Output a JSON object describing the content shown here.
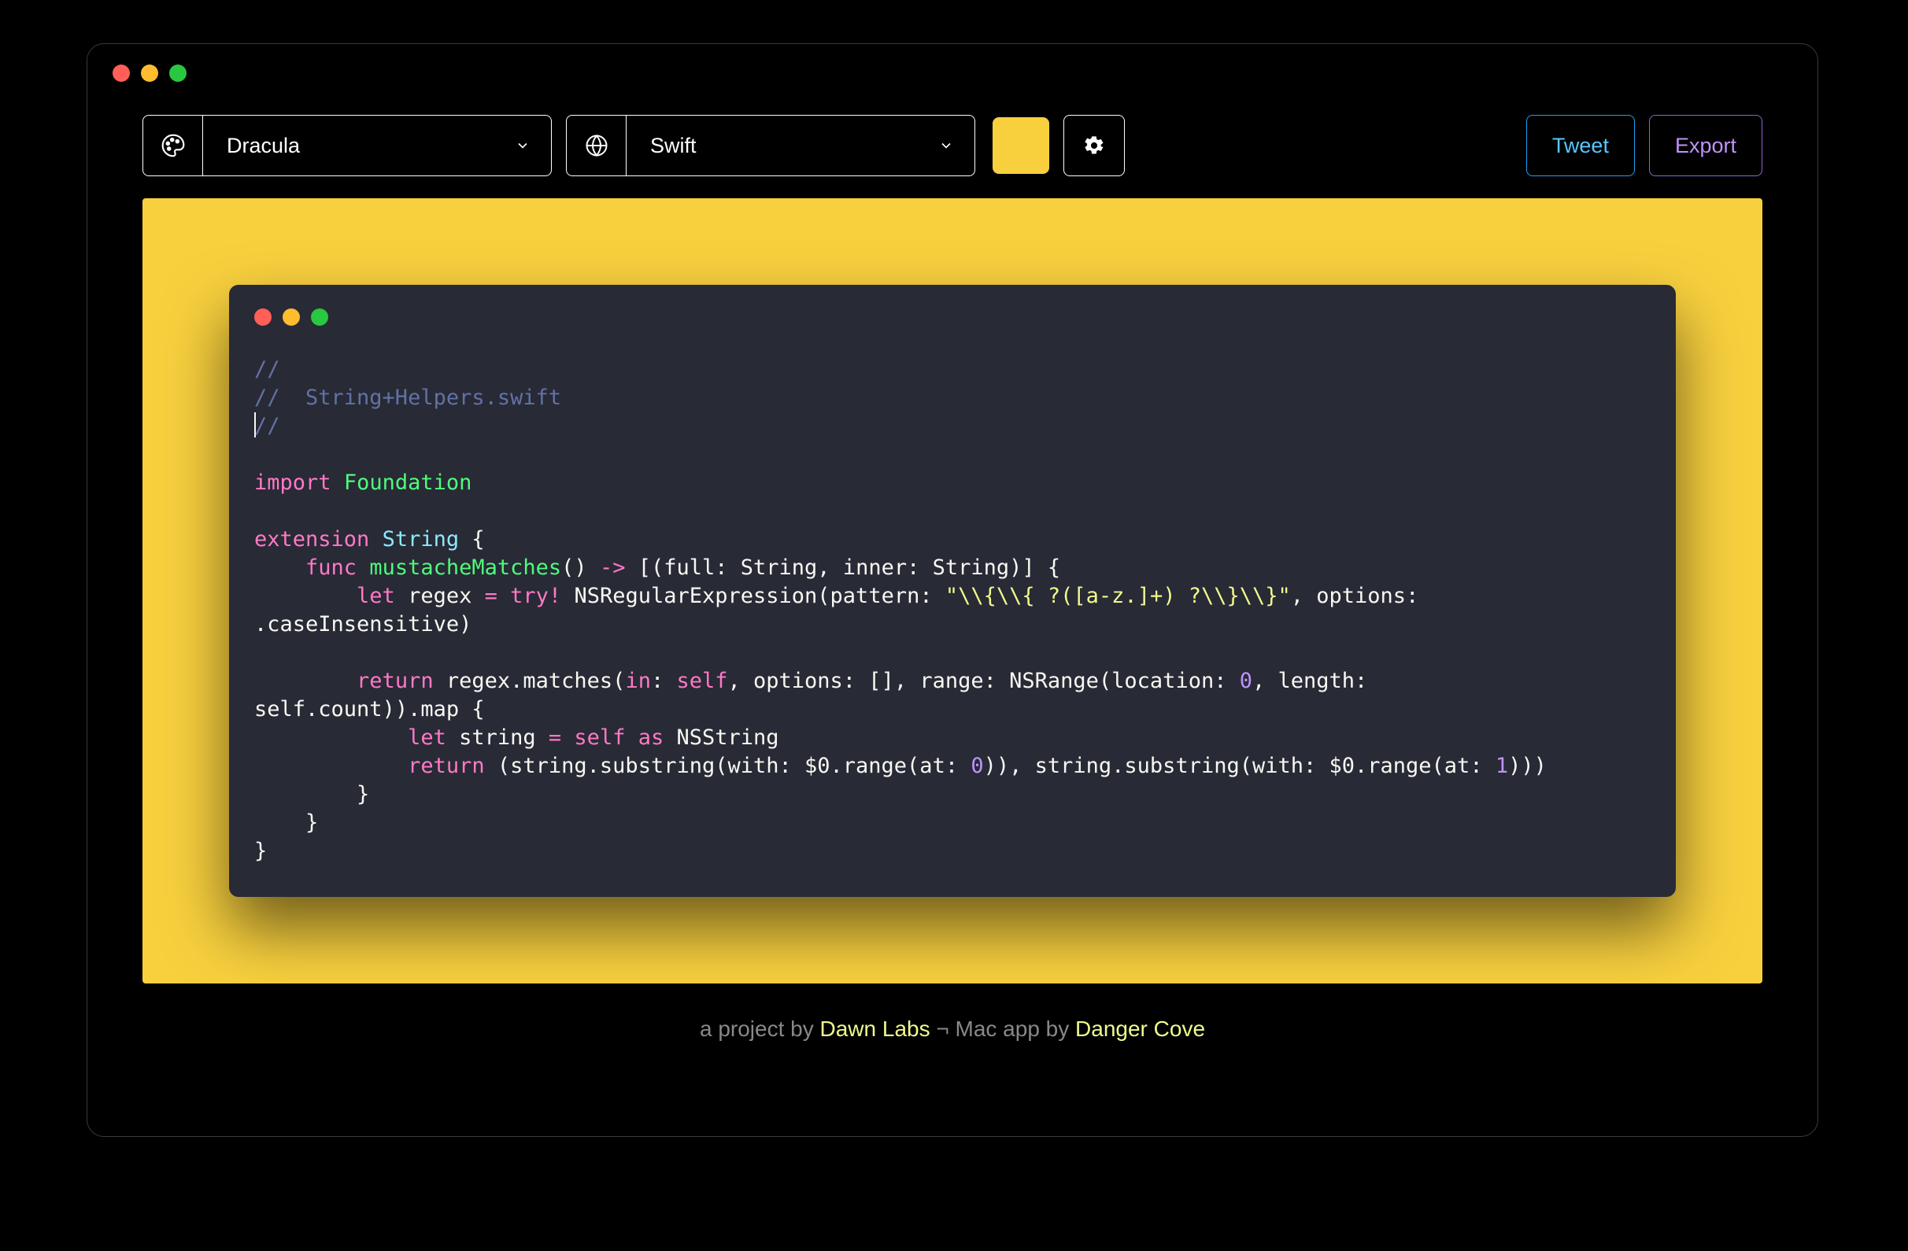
{
  "toolbar": {
    "theme_select": {
      "label": "Dracula"
    },
    "lang_select": {
      "label": "Swift"
    },
    "tweet_label": "Tweet",
    "export_label": "Export",
    "color_hex": "#f8d03e"
  },
  "code": {
    "c1": "//",
    "c2": "//  String+Helpers.swift",
    "c3": "//",
    "import_kw": "import",
    "import_mod": "Foundation",
    "ext_kw": "extension",
    "ext_type": "String",
    "brace_open": " {",
    "func_kw": "func",
    "func_name": "mustacheMatches",
    "func_sig_rest": "() ",
    "arrow": "->",
    "ret_type": " [(full: String, inner: String)] {",
    "let_kw": "let",
    "regex_var": " regex ",
    "eq": "=",
    "try_kw": " try",
    "bang": "!",
    "nsre_call": " NSRegularExpression(pattern: ",
    "pattern_str": "\"\\\\{\\\\{ ?([a-z.]+) ?\\\\}\\\\}\"",
    "opts_tail": ", options: ",
    "caseins": ".caseInsensitive",
    "close_paren": ")",
    "return_kw": "return",
    "matches_call_a": " regex.matches(",
    "in_kw": "in",
    "self_kw": "self",
    "matches_call_b": ", options: [], range: NSRange(location: ",
    "zero": "0",
    "len_tail": ", length: ",
    "selfcount": "self.count",
    "map_tail": ")).map {",
    "let2": "let",
    "string_decl": " string ",
    "eq2": "=",
    "selfas": " self ",
    "as_kw": "as",
    "nsstring": " NSString",
    "ret2": "return",
    "tup_a": " (string.substring(with: $0.range(at: ",
    "num0": "0",
    "tup_b": ")), string.substring(with: $0.range(at: ",
    "num1": "1",
    "tup_c": ")))",
    "brace1": "        }",
    "brace2": "    }",
    "brace3": "}"
  },
  "footer": {
    "prefix": "a project by ",
    "link1": "Dawn Labs",
    "mid": " ¬ Mac app by ",
    "link2": "Danger Cove"
  }
}
